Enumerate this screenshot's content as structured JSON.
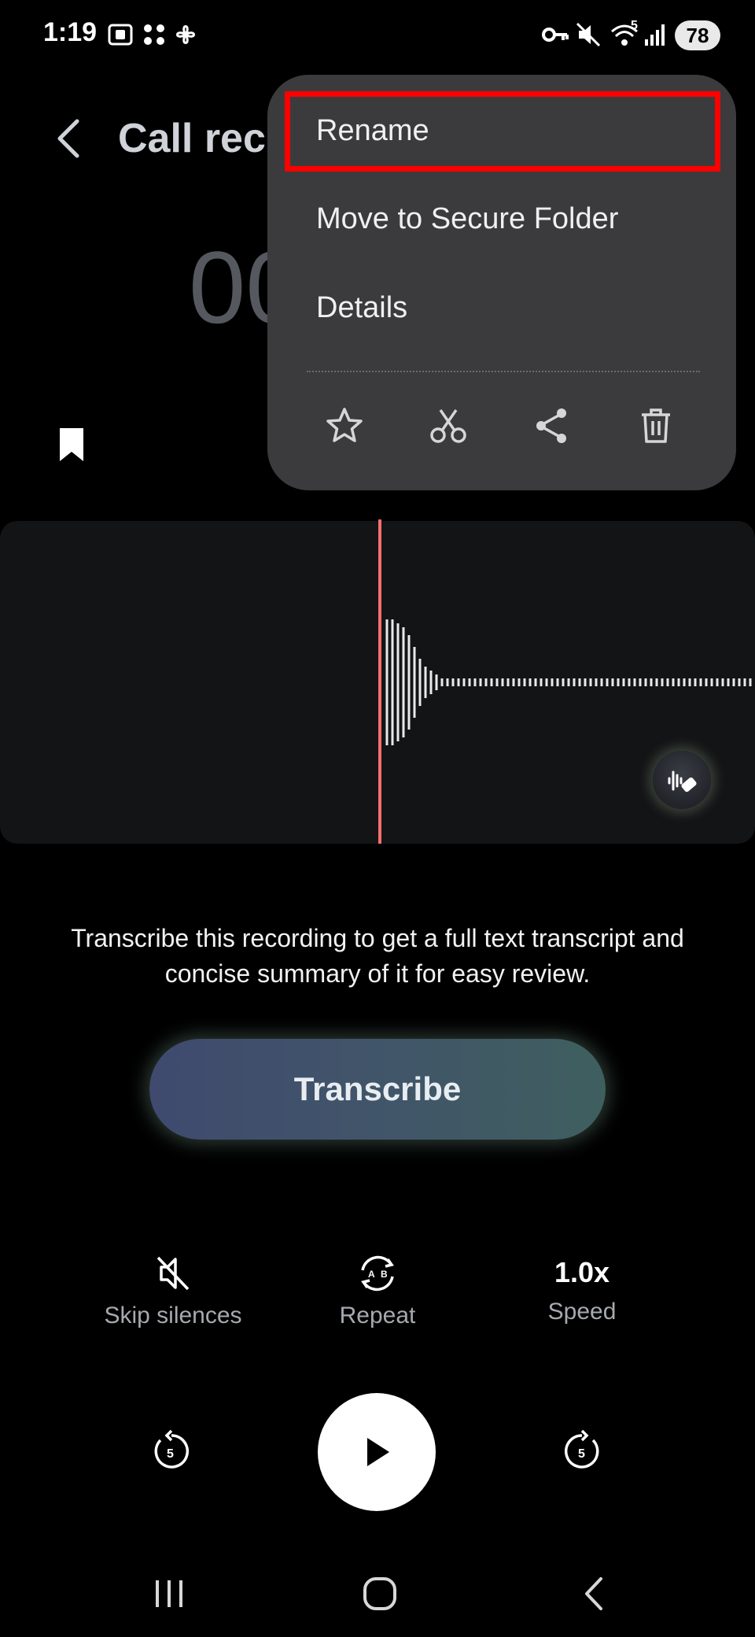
{
  "status_bar": {
    "time": "1:19",
    "battery": "78",
    "network": "5"
  },
  "header": {
    "title": "Call recording"
  },
  "recording": {
    "elapsed_partial": "00"
  },
  "menu": {
    "items": [
      "Rename",
      "Move to Secure Folder",
      "Details"
    ],
    "highlighted_item": "Rename",
    "icons": [
      "star-icon",
      "scissors-icon",
      "share-icon",
      "trash-icon"
    ]
  },
  "transcribe": {
    "description": "Transcribe this recording to get a full text transcript and concise summary of it for easy review.",
    "button_label": "Transcribe"
  },
  "controls": {
    "skip_silences_label": "Skip silences",
    "repeat_label": "Repeat",
    "speed_value": "1.0x",
    "speed_label": "Speed",
    "rewind_seconds": "5",
    "forward_seconds": "5"
  },
  "colors": {
    "background": "#000000",
    "menu_bg": "#3b3b3d",
    "highlight": "#ff0000",
    "playhead": "#ff6f6f"
  }
}
